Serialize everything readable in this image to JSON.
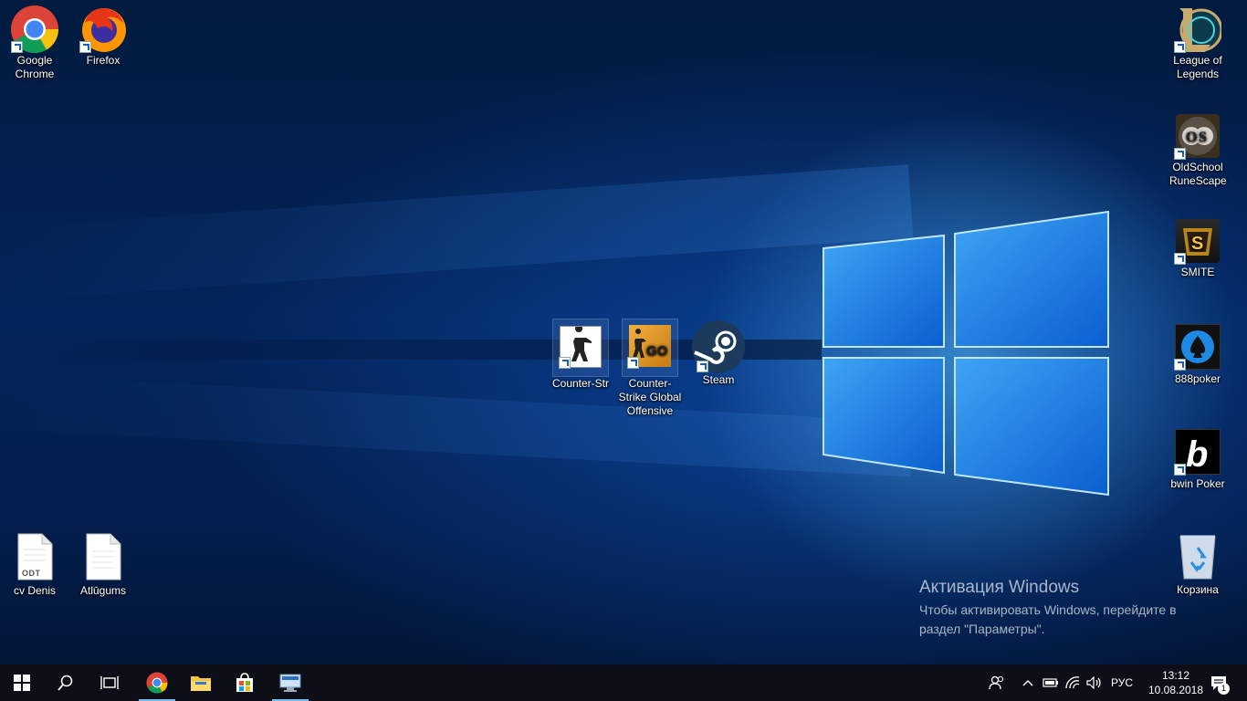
{
  "desktop_icons": {
    "chrome": "Google Chrome",
    "firefox": "Firefox",
    "lol": "League of Legends",
    "osrs": "OldSchool RuneScape",
    "smite": "SMITE",
    "cs": "Counter-Str",
    "csgo": "Counter-Strike Global Offensive",
    "steam": "Steam",
    "poker888": "888poker",
    "bwin": "bwin Poker",
    "cv": "cv Denis",
    "atlugums": "Atlūgums",
    "recycle": "Корзина",
    "odt_badge": "ODT"
  },
  "activation": {
    "title": "Активация Windows",
    "line1": "Чтобы активировать Windows, перейдите в",
    "line2": "раздел \"Параметры\"."
  },
  "taskbar": {
    "language": "РУС",
    "time": "13:12",
    "date": "10.08.2018",
    "notification_count": "1"
  },
  "colors": {
    "accent": "#76b9ed",
    "taskbar": "#0c0f17"
  }
}
